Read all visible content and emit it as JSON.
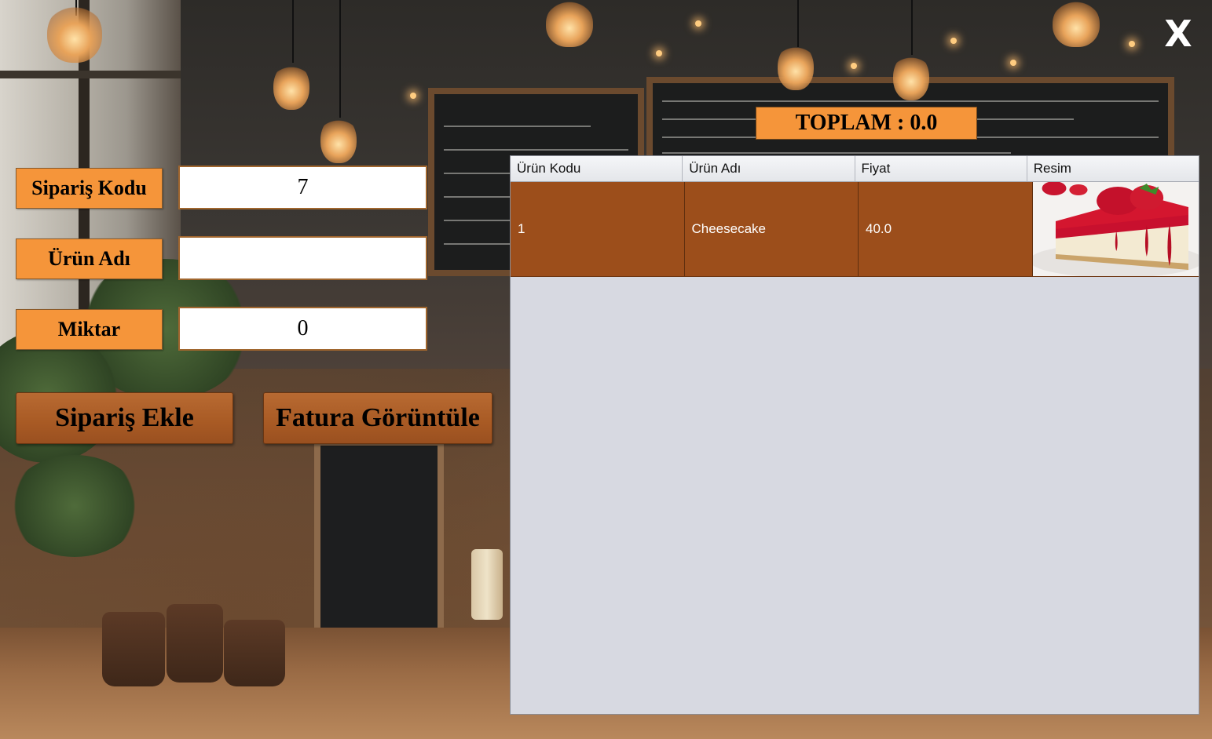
{
  "window": {
    "close_label": "X"
  },
  "total": {
    "label": "TOPLAM : 0.0"
  },
  "form": {
    "order_code": {
      "label": "Sipariş Kodu",
      "value": "7"
    },
    "product_name": {
      "label": "Ürün Adı",
      "value": ""
    },
    "quantity": {
      "label": "Miktar",
      "value": "0"
    }
  },
  "actions": {
    "add_order_label": "Sipariş Ekle",
    "view_invoice_label": "Fatura Görüntüle"
  },
  "table": {
    "columns": [
      "Ürün Kodu",
      "Ürün Adı",
      "Fiyat",
      "Resim"
    ],
    "rows": [
      {
        "code": "1",
        "name": "Cheesecake",
        "price": "40.0",
        "image": "strawberry-cheesecake-image"
      }
    ]
  },
  "colors": {
    "label_bg": "#f5953a",
    "button_bg": "#a85a24",
    "row_bg": "#9c4e1b",
    "table_bg": "#d7d9e1"
  }
}
